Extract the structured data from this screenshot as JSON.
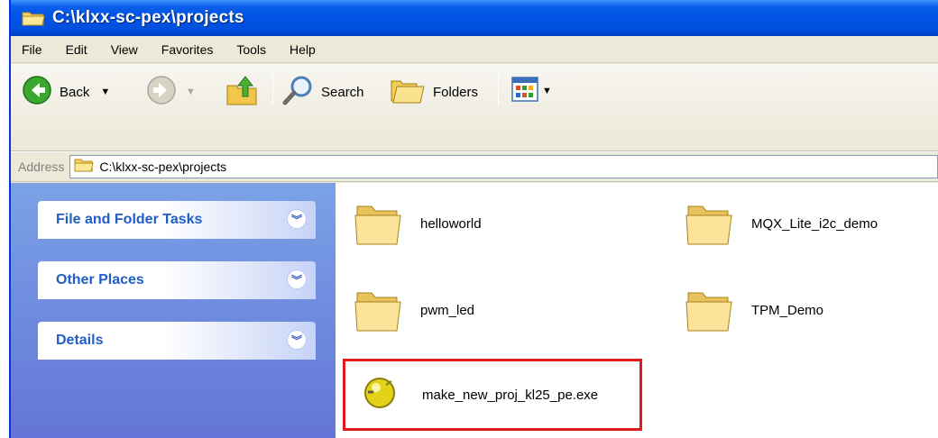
{
  "window": {
    "title": "C:\\klxx-sc-pex\\projects"
  },
  "menu": [
    {
      "label": "File"
    },
    {
      "label": "Edit"
    },
    {
      "label": "View"
    },
    {
      "label": "Favorites"
    },
    {
      "label": "Tools"
    },
    {
      "label": "Help"
    }
  ],
  "toolbar": {
    "back_label": "Back",
    "search_label": "Search",
    "folders_label": "Folders"
  },
  "address": {
    "label": "Address",
    "path": "C:\\klxx-sc-pex\\projects"
  },
  "tasks": [
    {
      "label": "File and Folder Tasks"
    },
    {
      "label": "Other Places"
    },
    {
      "label": "Details"
    }
  ],
  "files": [
    {
      "name": "helloworld",
      "icon": "folder-icon"
    },
    {
      "name": "MQX_Lite_i2c_demo",
      "icon": "folder-icon"
    },
    {
      "name": "pwm_led",
      "icon": "folder-icon"
    },
    {
      "name": "TPM_Demo",
      "icon": "folder-icon"
    },
    {
      "name": "make_new_proj_kl25_pe.exe",
      "icon": "exe-icon"
    }
  ],
  "colors": {
    "titlebar": "#0054e3",
    "task_label": "#215dc6",
    "highlight": "#e11b1b"
  }
}
